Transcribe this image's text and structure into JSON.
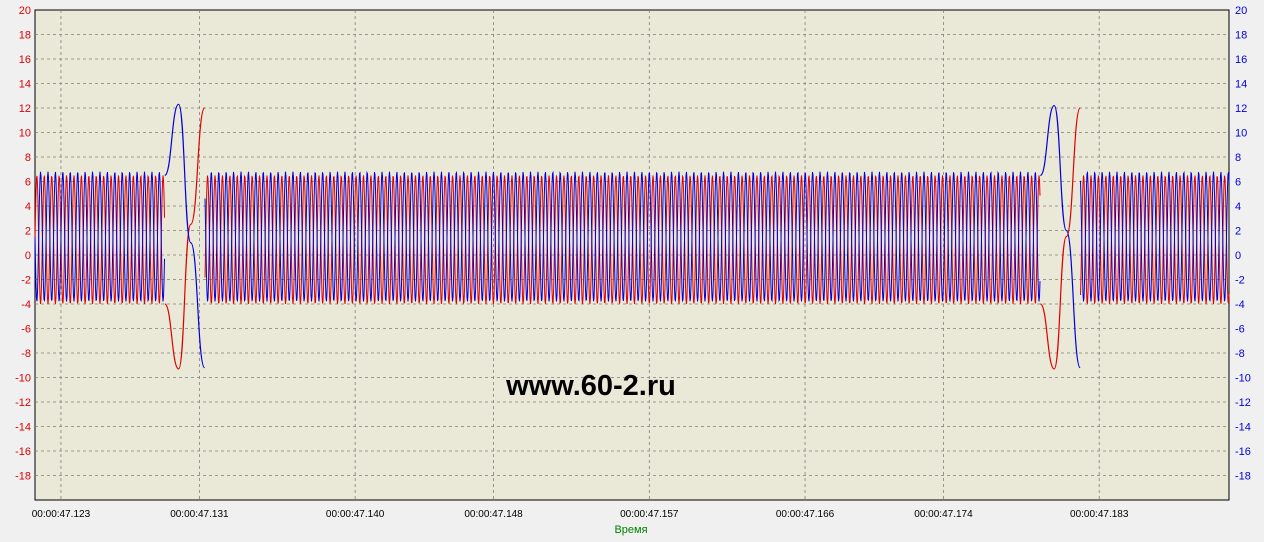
{
  "chart_data": {
    "type": "line",
    "title": "",
    "xlabel": "Время",
    "ylabel": "",
    "ylim": [
      -20,
      20
    ],
    "y_ticks": [
      20,
      18,
      16,
      14,
      12,
      10,
      8,
      6,
      4,
      2,
      0,
      -2,
      -4,
      -6,
      -8,
      -10,
      -12,
      -14,
      -16,
      -18
    ],
    "x_ticks": [
      "00:00:47.123",
      "00:00:47.131",
      "00:00:47.140",
      "00:00:47.148",
      "00:00:47.157",
      "00:00:47.166",
      "00:00:47.174",
      "00:00:47.183"
    ],
    "xlim": [
      "00:00:47.1215",
      "00:00:47.1905"
    ],
    "grid": true,
    "watermark": "www.60-2.ru",
    "colors": {
      "red": "#e00000",
      "blue": "#0000e0",
      "background": "#eae8d6",
      "grid": "#808080",
      "xlabel": "#008000"
    },
    "series": [
      {
        "color": "red",
        "axis": "left",
        "oscillation": {
          "period": 0.000429,
          "max": 6.5,
          "min": -4.0
        },
        "gaps": [
          [
            "00:00:47.1290",
            "00:00:47.1313"
          ],
          [
            "00:00:47.1796",
            "00:00:47.1819"
          ]
        ],
        "pulses": [
          {
            "x": [
              "00:00:47.1290",
              "00:00:47.1298",
              "00:00:47.1305",
              "00:00:47.1313"
            ],
            "y": [
              -4,
              -9.3,
              2.5,
              12
            ]
          },
          {
            "x": [
              "00:00:47.1796",
              "00:00:47.1804",
              "00:00:47.1811",
              "00:00:47.1819"
            ],
            "y": [
              -4,
              -9.3,
              1.5,
              12
            ]
          }
        ]
      },
      {
        "color": "blue",
        "axis": "right",
        "oscillation": {
          "period": 0.000429,
          "max": 6.8,
          "min": -3.8
        },
        "gaps": [
          [
            "00:00:47.1290",
            "00:00:47.1313"
          ],
          [
            "00:00:47.1796",
            "00:00:47.1819"
          ]
        ],
        "pulses": [
          {
            "x": [
              "00:00:47.1290",
              "00:00:47.1298",
              "00:00:47.1305",
              "00:00:47.1313"
            ],
            "y": [
              6.5,
              12.3,
              1.0,
              -9.2
            ]
          },
          {
            "x": [
              "00:00:47.1796",
              "00:00:47.1804",
              "00:00:47.1811",
              "00:00:47.1819"
            ],
            "y": [
              6.5,
              12.2,
              2.0,
              -9.2
            ]
          }
        ]
      }
    ]
  }
}
